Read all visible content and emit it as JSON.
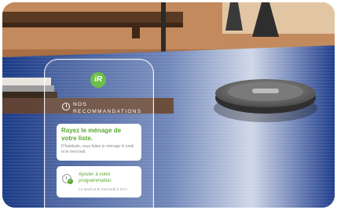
{
  "scene": {
    "description_icons": [
      "robot-vacuum",
      "rug",
      "table"
    ]
  },
  "app": {
    "logo_text": "iR",
    "section_title": "NOS\nRECOMMANDATIONS",
    "card_schedule_suggestion": {
      "title": "Rayez le ménage de votre liste.",
      "text": "D'habitude, vous faites le ménage le lundi et le mercredi."
    },
    "card_add_schedule": {
      "title": "Ajouter à votre programmation",
      "text": "Le lundi et le mercredi à 10 h",
      "icon": "clock-check-icon"
    }
  },
  "colors": {
    "accent_green": "#5aa832",
    "logo_green": "#6cc04a",
    "rug_blue": "#1f3f8f"
  }
}
